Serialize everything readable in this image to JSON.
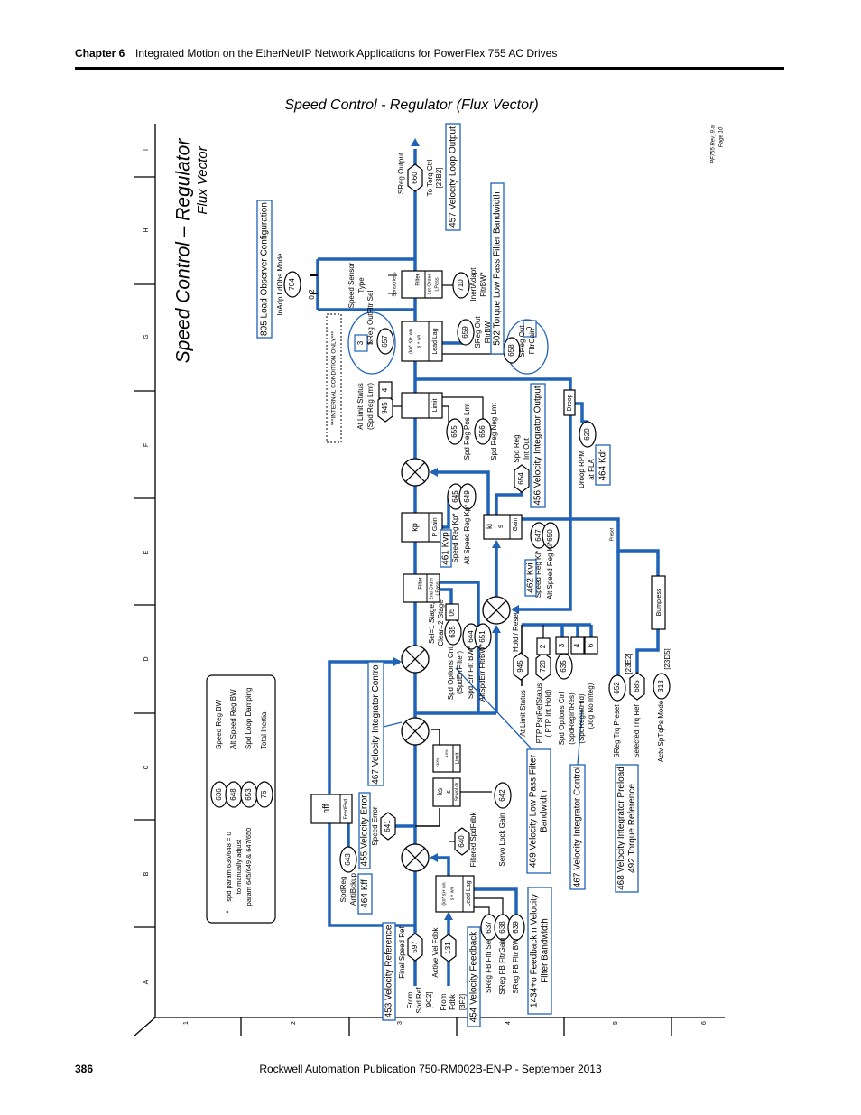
{
  "header": {
    "chapter": "Chapter 6",
    "title": "Integrated Motion on the EtherNet/IP Network Applications for PowerFlex 755 AC Drives"
  },
  "page_title": "Speed Control - Regulator (Flux Vector)",
  "footer": {
    "page_number": "386",
    "publication": "Rockwell Automation Publication 750-RM002B-EN-P - September 2013"
  },
  "colors": {
    "line": "#1f62b8",
    "callout": "#1f62b8",
    "ink": "#000000"
  },
  "diagram": {
    "title": "Speed Control – Regulator",
    "subtitle": "Flux Vector",
    "rev": "PF755 Rev_9.a",
    "page": "Page 10",
    "rows": [
      "I",
      "H",
      "G",
      "F",
      "E",
      "D",
      "C",
      "B",
      "A"
    ],
    "cols": [
      "1",
      "2",
      "3",
      "4",
      "5",
      "6"
    ]
  },
  "callouts": {
    "c805": "805 Load Observer Configuration",
    "c457": "457 Velocity Loop Output",
    "c502": "502 Torque Low Pass Filter Bandwidth",
    "c456": "456 Velocity Integrator Output",
    "c464kdr": "464 Kdr",
    "c461": "461 Kvp",
    "c462": "462 Kvi",
    "c467a": "467 Velocity Integrator Control",
    "c455": "455 Velocity Error",
    "c464kff": "464 Kff",
    "c453": "453 Velocity Reference",
    "c454": "454 Velocity Feedback",
    "c1434a": "1434+o Feedback n Velocity",
    "c1434b": "Filter Bandwidth",
    "c469a": "469 Velocity Low Pass Filter",
    "c469b": "Bandwidth",
    "c467b": "467 Velocity Integrator Control",
    "c468": "468 Velocity Integrator Preload",
    "c492": "492 Torque Reference"
  },
  "params": {
    "p660": "660",
    "p704": "704",
    "p710": "710",
    "p657": "657",
    "p659": "659",
    "p658": "658",
    "p945a": "945",
    "p655": "655",
    "p656": "656",
    "p654": "654",
    "p620": "620",
    "p645": "645",
    "p649": "649",
    "p647": "647",
    "p650": "650",
    "p635a": "635",
    "p644": "644",
    "p651": "651",
    "p945b": "945",
    "p720": "720",
    "p635b": "635",
    "p652": "652",
    "p685": "685",
    "p313": "313",
    "p642": "642",
    "p640": "640",
    "p641": "641",
    "p643": "643",
    "p597": "597",
    "p131": "131",
    "p637": "637",
    "p638": "638",
    "p639": "639",
    "p636": "636",
    "p648": "648",
    "p653": "653",
    "p76": "76"
  },
  "bitboxes": {
    "b3": "3",
    "b0": "0",
    "b4": "4",
    "b05": "05",
    "b2": "2",
    "b3b": "3",
    "b4b": "4",
    "b6": "6"
  },
  "blocks": {
    "filter": "Filter",
    "first_order": "1st Order",
    "lpass": "LPass",
    "second_order": "2nd Order",
    "leadlag": "Lead Lag",
    "ll_num": "(kn* s)+ wn",
    "ll_den": "s + wn",
    "limit": "Limit",
    "kp": "kp",
    "pgain": "P Gain",
    "ki": "ki",
    "s": "s",
    "igain": "I Gain",
    "droop": "Droop",
    "bumpless": "Bumpless",
    "ks": "ks",
    "servolck": "ServoLck",
    "nff": "nff",
    "feedfwd": "FeedFwd",
    "plus10": "+10%",
    "minus10": "-10%",
    "preset": "Preset",
    "sensorless": "Sensorless"
  },
  "labels": {
    "sreg_output": "SReg Output",
    "to_torq": "To Torq Ctrl",
    "to_torq_ref": "[23B2]",
    "inadp": "InAdp LdObs Mode",
    "v02": "0.2",
    "sst1": "Speed Sensor",
    "sst2": "Type",
    "inert1": "InertAdapt",
    "inert2": "FltrBW*",
    "outfltr": "SReg OutFltr Sel",
    "so1": "SReg Out",
    "so2": "FltrBW",
    "sg1": "SReg Out",
    "sg2": "FltrGain",
    "internal": "***INTERNAL CONDITION ONLY***",
    "als1": "At Limit Status",
    "als2": "(Spd Reg Lmt)",
    "poslmt": "Spd Reg Pos Lmt",
    "neglmt": "Spd Reg Neg Lmt",
    "io1": "Spd Reg",
    "io2": "Int Out",
    "dr1": "Droop RPM",
    "dr2": "at FLA",
    "kp1": "Speed Reg Kp*",
    "kp2": "Alt Speed Reg Kp*",
    "ki1": "Speed Reg Ki*",
    "ki2": "Alt Speed Reg Ki*",
    "stage1": "Sel=1 Stage,",
    "stage2": "Clear=2 Stage",
    "soc1": "Spd Options Cntl",
    "soc2": "(SpdErrFilter)",
    "efb": "Spd Err Filt BW*",
    "aefb": "AltSpdErr FltrBW*",
    "hold": "Hold / Reset",
    "als3": "At Limit Status",
    "ptp1": "PTP PsnRefStatus",
    "ptp2": "( PTP Int Hold)",
    "soc3": "Spd Options Ctrl",
    "soc4": "(SpdRegIntRes)",
    "soc5": "(SpdRegIntHld)",
    "soc6": "(Jog No Integ)",
    "tqp": "SReg Trq Preset",
    "str": "Selected Trq Ref",
    "r23e2": "[23E2]",
    "atm": "Actv SpTqPs Mode",
    "r23d5": "[23D5]",
    "slg": "Servo Lock Gain",
    "fsf": "Filtered SpdFdbk",
    "serr": "Speed Error",
    "ab1": "SpdReg",
    "ab2": "AntiBckup",
    "fsr": "Final Speed Ref",
    "fr1": "From",
    "fr2": "Spd Ref",
    "fr3": "[9C2]",
    "avf": "Active Vel Fdbk",
    "ff1": "From",
    "ff2": "Fdbk",
    "ff3": "[3F2]",
    "fb1": "SReg FB Fltr Sel",
    "fb2": "SReg FB FltrGain",
    "fb3": "SReg FB Fltr BW"
  },
  "note": {
    "n1": "Speed Reg BW",
    "n2": "Alt Speed Reg BW",
    "n3": "Spd Loop Damping",
    "n4": "Total Inertia",
    "star": "*",
    "t1": "spd param 636/648 = 0",
    "t2": "to manually adjust",
    "t3": "param 645/649 & 647/650"
  }
}
